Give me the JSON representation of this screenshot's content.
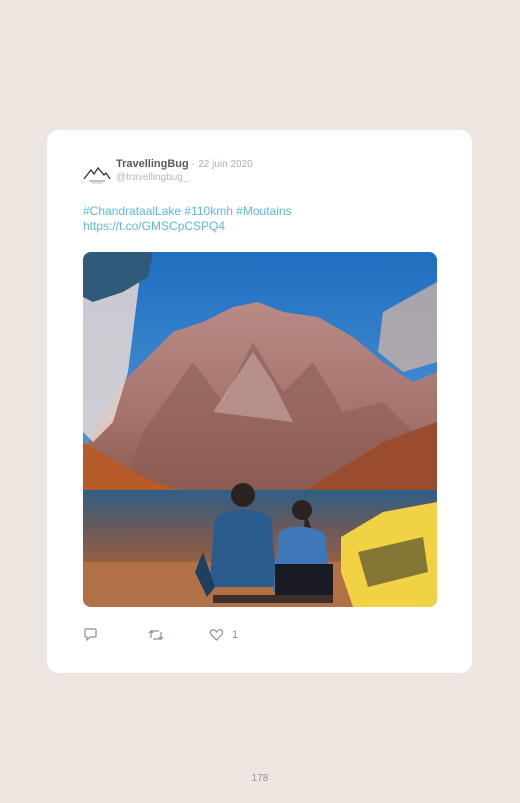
{
  "tweet": {
    "display_name": "TravellingBug",
    "separator": "·",
    "date": "22 juin 2020",
    "handle": "@travellingbug_",
    "avatar_text": "",
    "text_line1": "#ChandrataalLake #110kmh #Moutains",
    "text_line2": "https://t.co/GMSCpCSPQ4",
    "like_count": "1"
  },
  "icons": {
    "reply": "reply-icon",
    "retweet": "retweet-icon",
    "like": "heart-icon"
  },
  "colors": {
    "background": "#ede6e1",
    "card": "#ffffff",
    "link": "#5cb6e8",
    "name": "#555b60",
    "muted": "#a9b0b6"
  },
  "page": {
    "number": "178"
  }
}
